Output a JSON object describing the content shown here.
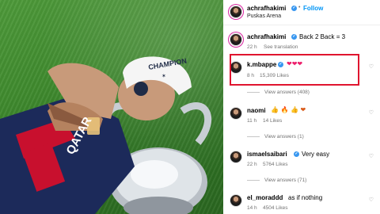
{
  "post": {
    "author": "achrafhakimi",
    "follow_label": "Follow",
    "location": "Puskas Arena",
    "caption_author": "achrafhakimi",
    "caption_text": "Back 2 Back = 3",
    "caption_age": "22 h",
    "see_translation": "See translation"
  },
  "photo": {
    "cap_text": "CHAMPION",
    "cap_sub": "✶",
    "shirt_text": "QATAR"
  },
  "comments": [
    {
      "user": "k.mbappe",
      "text": "❤❤❤",
      "age": "8 h",
      "likes": "15,309 Likes",
      "view_answers": "View answers (408)"
    },
    {
      "user": "naomi",
      "text": "👍 🔥 👍 ❤",
      "age": "11 h",
      "likes": "14 Likes",
      "view_answers": "View answers (1)"
    },
    {
      "user": "ismaelsaibari",
      "text": "Very easy",
      "age": "22 h",
      "likes": "5764 Likes",
      "view_answers": "View answers (71)"
    },
    {
      "user": "el_moraddd",
      "text": "as if nothing",
      "age": "14 h",
      "likes": "4504 Likes"
    }
  ],
  "icons": {
    "verified": "verified-badge-icon",
    "heart": "heart-outline-icon"
  },
  "colors": {
    "accent": "#0095f6",
    "highlight": "#e0152f",
    "verified": "#3897f0"
  }
}
